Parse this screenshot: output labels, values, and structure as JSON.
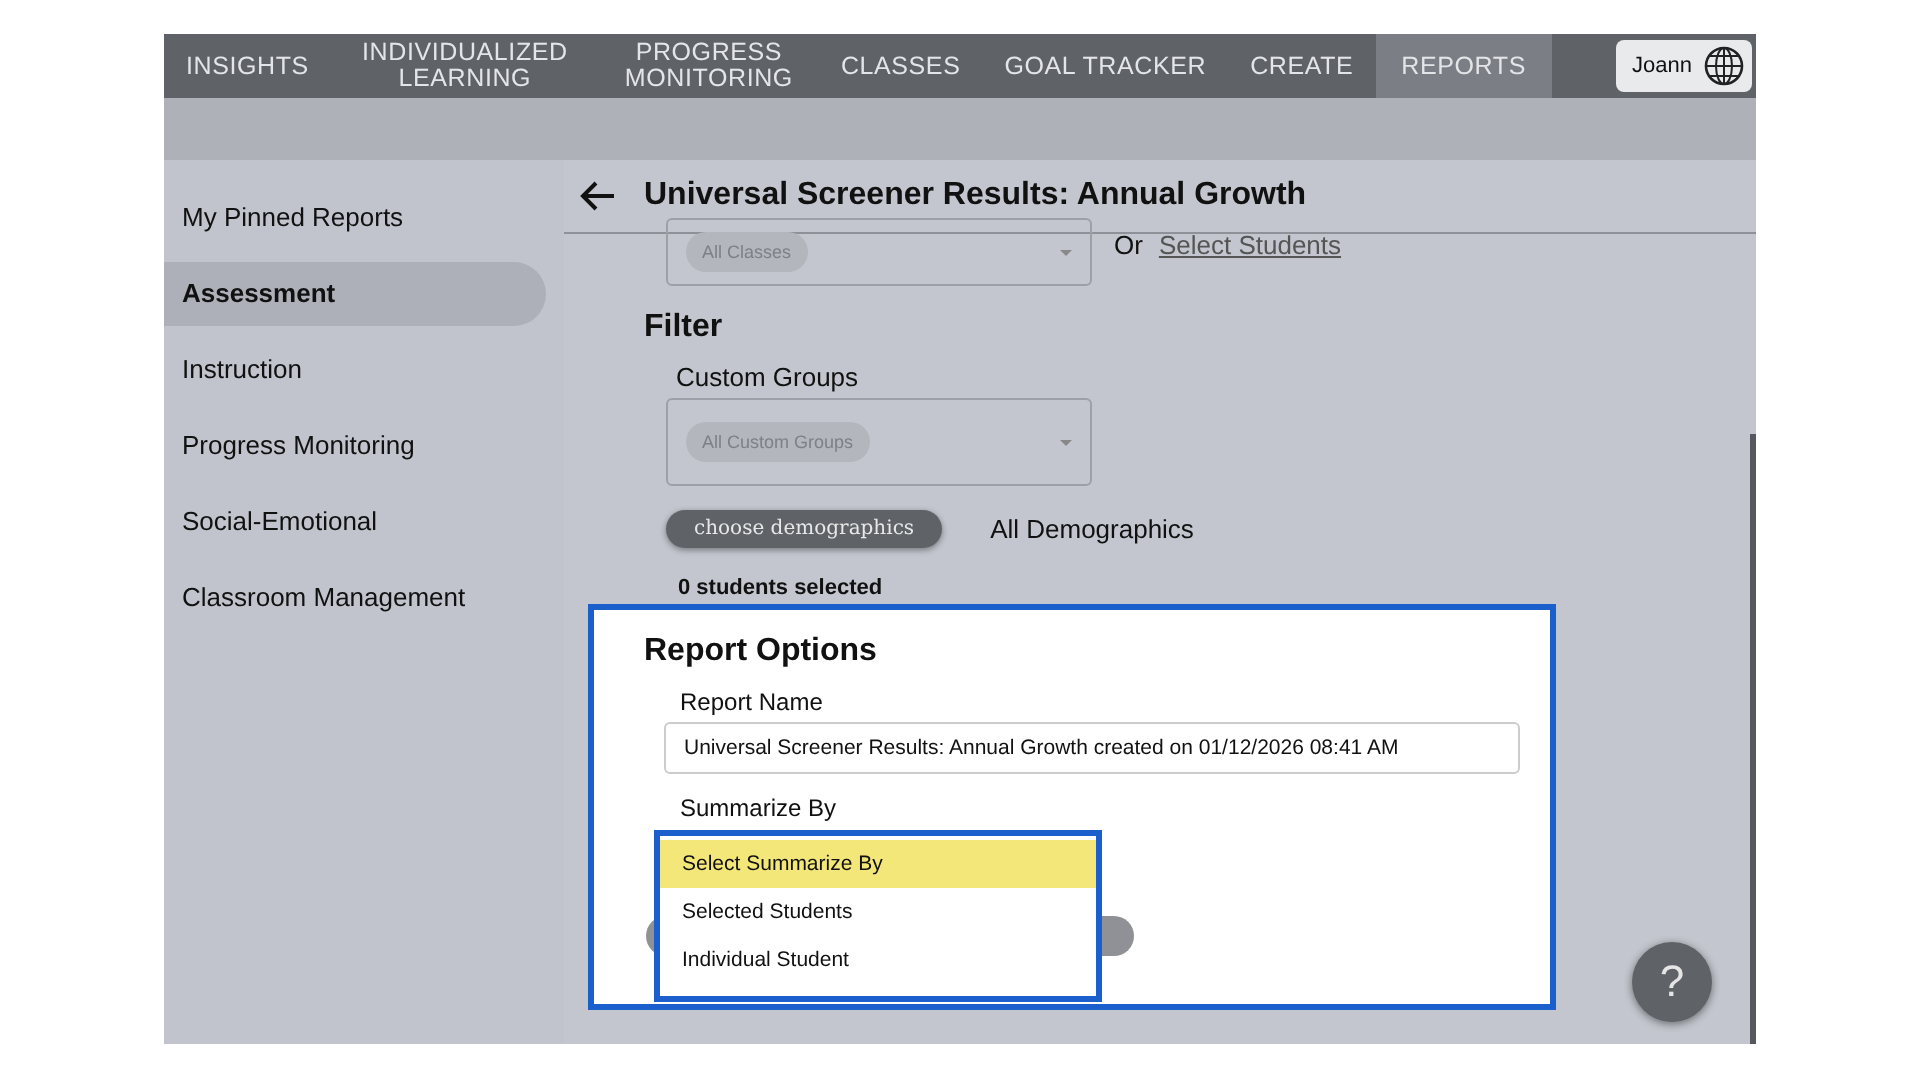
{
  "nav": {
    "tabs": [
      {
        "label": "INSIGHTS",
        "selected": false
      },
      {
        "label": "INDIVIDUALIZED LEARNING",
        "selected": false
      },
      {
        "label": "PROGRESS MONITORING",
        "selected": false
      },
      {
        "label": "CLASSES",
        "selected": false
      },
      {
        "label": "GOAL TRACKER",
        "selected": false
      },
      {
        "label": "CREATE",
        "selected": false
      },
      {
        "label": "REPORTS",
        "selected": true
      }
    ],
    "user": {
      "name": "Joann"
    }
  },
  "sidebar": {
    "items": [
      {
        "label": "My Pinned Reports",
        "selected": false
      },
      {
        "label": "Assessment",
        "selected": true
      },
      {
        "label": "Instruction",
        "selected": false
      },
      {
        "label": "Progress Monitoring",
        "selected": false
      },
      {
        "label": "Social-Emotional",
        "selected": false
      },
      {
        "label": "Classroom Management",
        "selected": false
      }
    ]
  },
  "page": {
    "title": "Universal Screener Results: Annual Growth",
    "classes": {
      "chip": "All Classes",
      "or_text": "Or",
      "link": "Select Students"
    },
    "filter": {
      "heading": "Filter",
      "groups_label": "Custom Groups",
      "groups_chip": "All Custom Groups",
      "demographics_button": "choose demographics",
      "demographics_value": "All Demographics",
      "students_selected": "0 students selected"
    },
    "report_options": {
      "heading": "Report Options",
      "name_label": "Report Name",
      "name_value": "Universal Screener Results: Annual Growth created on 01/12/2026 08:41 AM",
      "summarize_label": "Summarize By",
      "options": [
        {
          "label": "Select Summarize By",
          "selected": true
        },
        {
          "label": "Selected Students",
          "selected": false
        },
        {
          "label": "Individual Student",
          "selected": false
        }
      ]
    }
  },
  "help_button": {
    "label": "?"
  }
}
